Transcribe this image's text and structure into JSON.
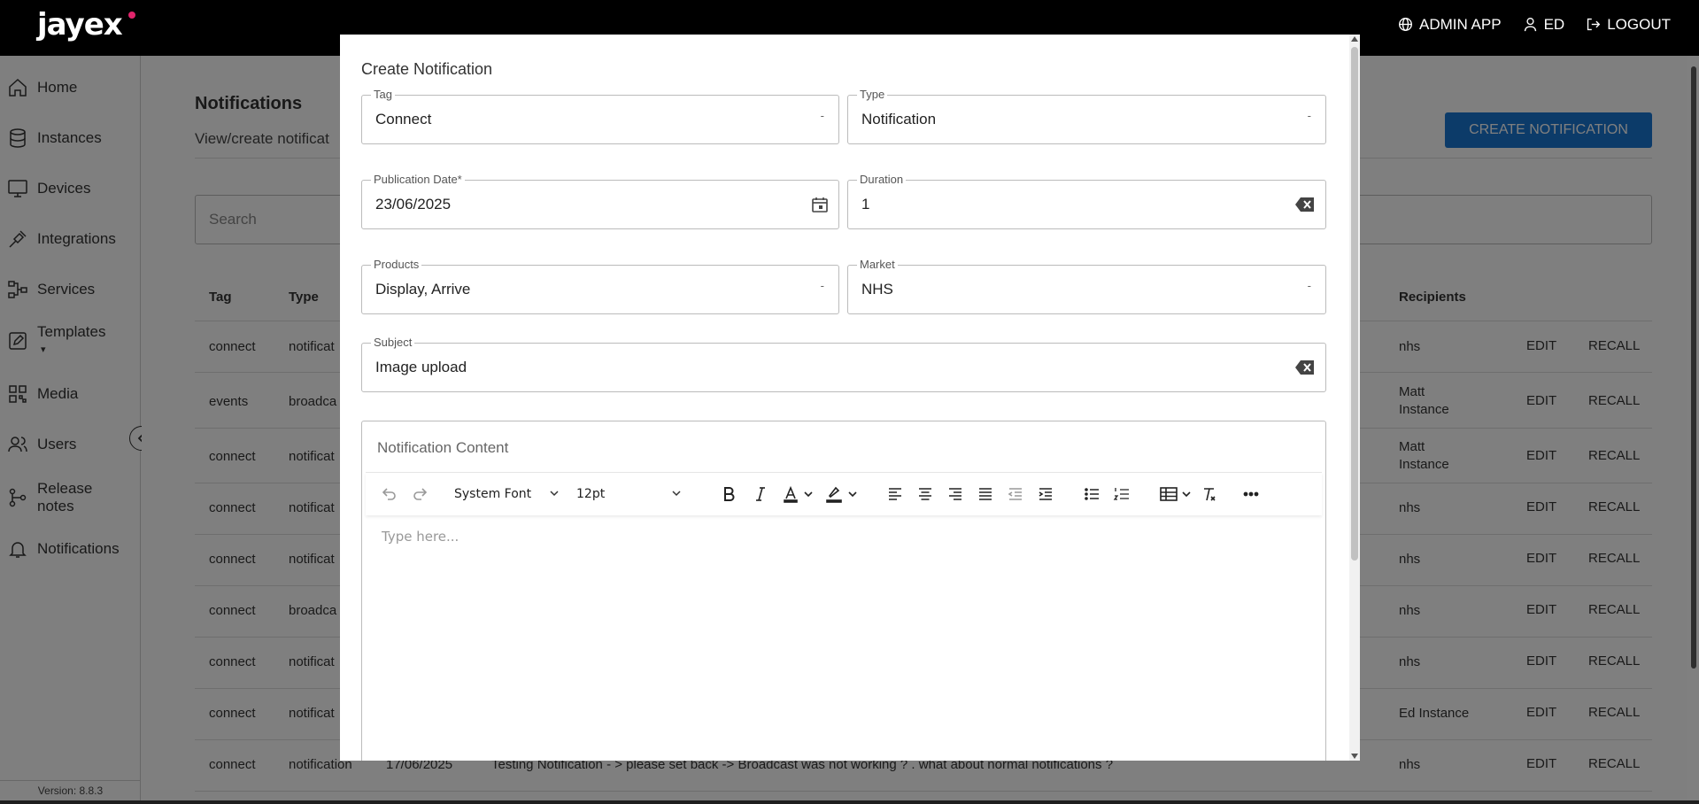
{
  "header": {
    "logo": "jayex",
    "admin_app": "ADMIN APP",
    "user": "ED",
    "logout": "LOGOUT"
  },
  "sidebar": {
    "items": [
      {
        "label": "Home",
        "icon": "home-icon"
      },
      {
        "label": "Instances",
        "icon": "database-icon"
      },
      {
        "label": "Devices",
        "icon": "monitor-icon"
      },
      {
        "label": "Integrations",
        "icon": "plug-icon"
      },
      {
        "label": "Services",
        "icon": "flow-icon"
      },
      {
        "label": "Templates",
        "icon": "edit-doc-icon"
      },
      {
        "label": "Media",
        "icon": "qr-icon"
      },
      {
        "label": "Users",
        "icon": "users-icon"
      },
      {
        "label": "Release notes",
        "icon": "branch-icon"
      },
      {
        "label": "Notifications",
        "icon": "bell-icon"
      }
    ],
    "templates_caret": "▾",
    "version": "Version: 8.8.3"
  },
  "page": {
    "title": "Notifications",
    "subtitle": "View/create notificat",
    "create_button": "CREATE NOTIFICATION",
    "search_placeholder": "Search"
  },
  "table": {
    "columns": {
      "tag": "Tag",
      "type": "Type",
      "recipients": "Recipients"
    },
    "rows": [
      {
        "tag": "connect",
        "type": "notificat",
        "recipients": "nhs"
      },
      {
        "tag": "events",
        "type": "broadca",
        "recipients": "Matt Instance"
      },
      {
        "tag": "connect",
        "type": "notificat",
        "recipients": "Matt Instance"
      },
      {
        "tag": "connect",
        "type": "notificat",
        "recipients": "nhs"
      },
      {
        "tag": "connect",
        "type": "notificat",
        "recipients": "nhs"
      },
      {
        "tag": "connect",
        "type": "broadca",
        "recipients": "nhs"
      },
      {
        "tag": "connect",
        "type": "notificat",
        "recipients": "nhs"
      },
      {
        "tag": "connect",
        "type": "notificat",
        "recipients": "Ed Instance"
      },
      {
        "tag": "connect",
        "type": "notification",
        "date": "17/06/2025",
        "subject": "Testing Notification - > please set back -> Broadcast was not working ? . what about normal notifications ?",
        "recipients": "nhs"
      }
    ],
    "edit_label": "EDIT",
    "recall_label": "RECALL"
  },
  "modal": {
    "title": "Create Notification",
    "tag": {
      "label": "Tag",
      "value": "Connect"
    },
    "type": {
      "label": "Type",
      "value": "Notification"
    },
    "publication_date": {
      "label": "Publication Date*",
      "value": "23/06/2025"
    },
    "duration": {
      "label": "Duration",
      "value": "1"
    },
    "products": {
      "label": "Products",
      "value": "Display, Arrive"
    },
    "market": {
      "label": "Market",
      "value": "NHS"
    },
    "subject": {
      "label": "Subject",
      "value": "Image upload"
    },
    "content": {
      "label": "Notification Content",
      "font_family": "System Font",
      "font_size": "12pt",
      "placeholder": "Type here..."
    },
    "dropdown_caret": "-"
  }
}
